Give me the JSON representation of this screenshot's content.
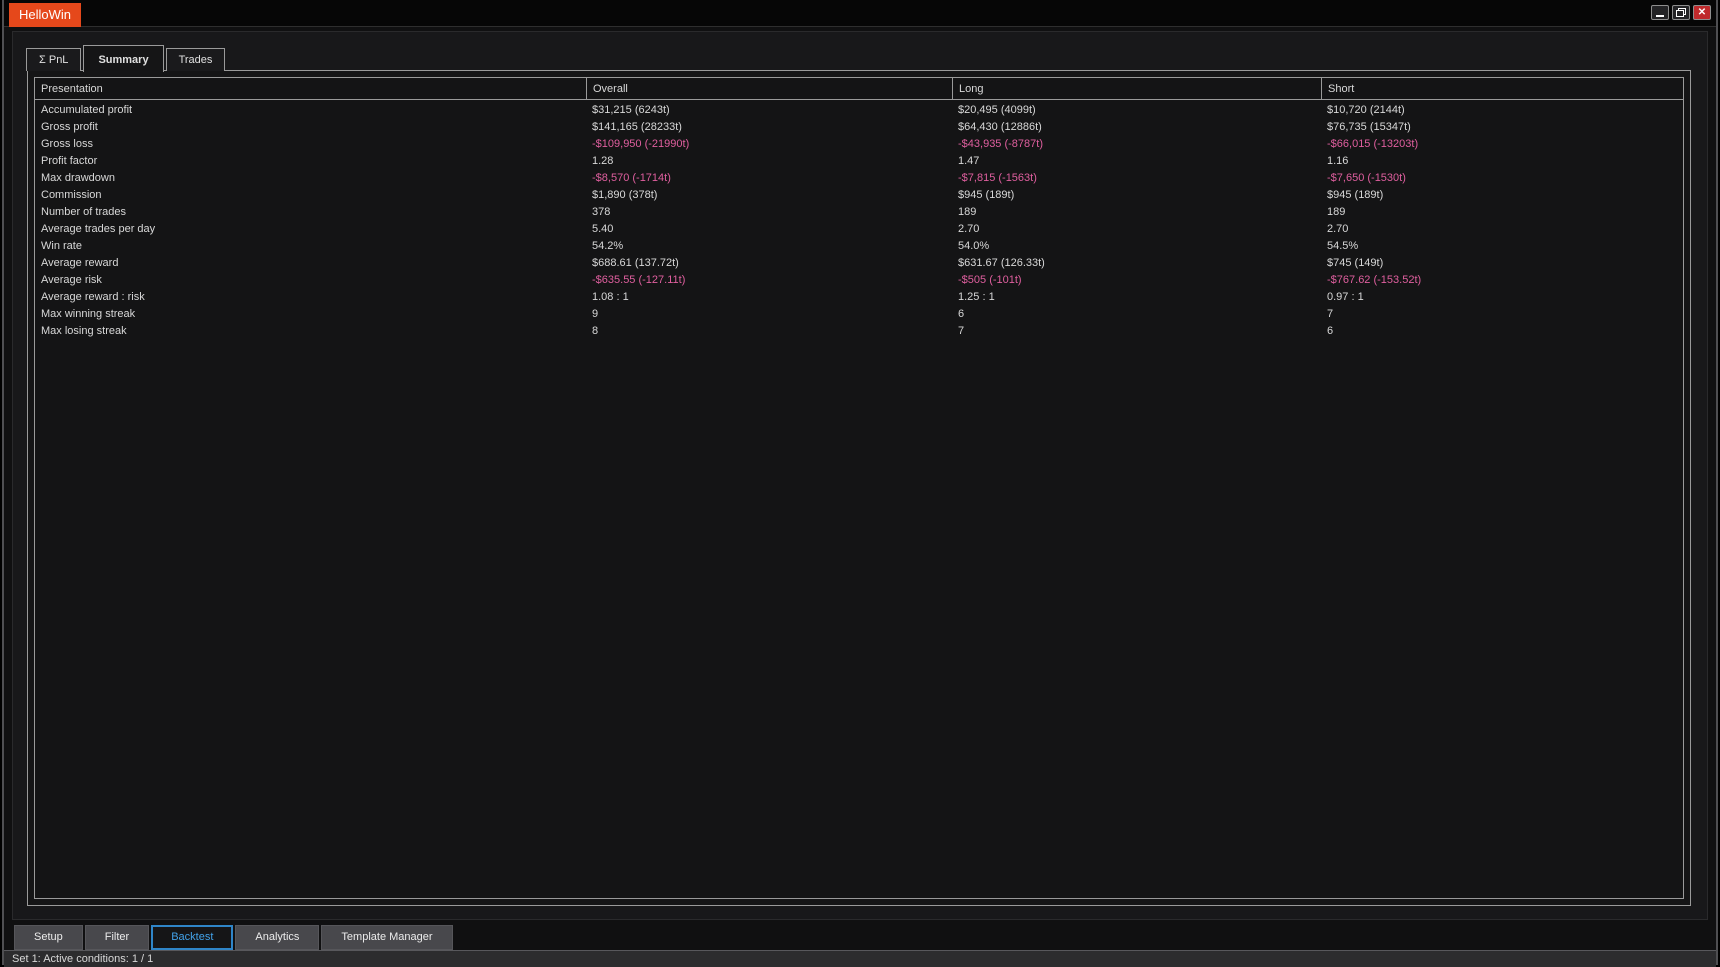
{
  "window": {
    "title": "HelloWin"
  },
  "colors": {
    "title_accent": "#e5481b",
    "negative_value": "#e05f9f",
    "active_tab_blue": "#42a1e8",
    "close_button_red": "#bf2a2c"
  },
  "top_tabs": [
    {
      "label": "Σ PnL",
      "active": false
    },
    {
      "label": "Summary",
      "active": true
    },
    {
      "label": "Trades",
      "active": false
    }
  ],
  "table": {
    "columns": [
      "Presentation",
      "Overall",
      "Long",
      "Short"
    ],
    "rows": [
      {
        "label": "Accumulated profit",
        "cells": [
          {
            "text": "$31,215 (6243t)",
            "neg": false
          },
          {
            "text": "$20,495 (4099t)",
            "neg": false
          },
          {
            "text": "$10,720 (2144t)",
            "neg": false
          }
        ]
      },
      {
        "label": "Gross profit",
        "cells": [
          {
            "text": "$141,165 (28233t)",
            "neg": false
          },
          {
            "text": "$64,430 (12886t)",
            "neg": false
          },
          {
            "text": "$76,735 (15347t)",
            "neg": false
          }
        ]
      },
      {
        "label": "Gross loss",
        "cells": [
          {
            "text": "-$109,950 (-21990t)",
            "neg": true
          },
          {
            "text": "-$43,935 (-8787t)",
            "neg": true
          },
          {
            "text": "-$66,015 (-13203t)",
            "neg": true
          }
        ]
      },
      {
        "label": "Profit factor",
        "cells": [
          {
            "text": "1.28",
            "neg": false
          },
          {
            "text": "1.47",
            "neg": false
          },
          {
            "text": "1.16",
            "neg": false
          }
        ]
      },
      {
        "label": "Max drawdown",
        "cells": [
          {
            "text": "-$8,570 (-1714t)",
            "neg": true
          },
          {
            "text": "-$7,815 (-1563t)",
            "neg": true
          },
          {
            "text": "-$7,650 (-1530t)",
            "neg": true
          }
        ]
      },
      {
        "label": "Commission",
        "cells": [
          {
            "text": "$1,890 (378t)",
            "neg": false
          },
          {
            "text": "$945 (189t)",
            "neg": false
          },
          {
            "text": "$945 (189t)",
            "neg": false
          }
        ]
      },
      {
        "label": "Number of trades",
        "cells": [
          {
            "text": "378",
            "neg": false
          },
          {
            "text": "189",
            "neg": false
          },
          {
            "text": "189",
            "neg": false
          }
        ]
      },
      {
        "label": "Average trades per day",
        "cells": [
          {
            "text": "5.40",
            "neg": false
          },
          {
            "text": "2.70",
            "neg": false
          },
          {
            "text": "2.70",
            "neg": false
          }
        ]
      },
      {
        "label": "Win rate",
        "cells": [
          {
            "text": "54.2%",
            "neg": false
          },
          {
            "text": "54.0%",
            "neg": false
          },
          {
            "text": "54.5%",
            "neg": false
          }
        ]
      },
      {
        "label": "Average reward",
        "cells": [
          {
            "text": "$688.61 (137.72t)",
            "neg": false
          },
          {
            "text": "$631.67 (126.33t)",
            "neg": false
          },
          {
            "text": "$745 (149t)",
            "neg": false
          }
        ]
      },
      {
        "label": "Average risk",
        "cells": [
          {
            "text": "-$635.55 (-127.11t)",
            "neg": true
          },
          {
            "text": "-$505 (-101t)",
            "neg": true
          },
          {
            "text": "-$767.62 (-153.52t)",
            "neg": true
          }
        ]
      },
      {
        "label": "Average reward : risk",
        "cells": [
          {
            "text": "1.08 : 1",
            "neg": false
          },
          {
            "text": "1.25 : 1",
            "neg": false
          },
          {
            "text": "0.97 : 1",
            "neg": false
          }
        ]
      },
      {
        "label": "Max winning streak",
        "cells": [
          {
            "text": "9",
            "neg": false
          },
          {
            "text": "6",
            "neg": false
          },
          {
            "text": "7",
            "neg": false
          }
        ]
      },
      {
        "label": "Max losing streak",
        "cells": [
          {
            "text": "8",
            "neg": false
          },
          {
            "text": "7",
            "neg": false
          },
          {
            "text": "6",
            "neg": false
          }
        ]
      }
    ]
  },
  "bottom_tabs": [
    {
      "label": "Setup",
      "active": false
    },
    {
      "label": "Filter",
      "active": false
    },
    {
      "label": "Backtest",
      "active": true
    },
    {
      "label": "Analytics",
      "active": false
    },
    {
      "label": "Template Manager",
      "active": false
    }
  ],
  "status_bar": {
    "text": "Set 1: Active conditions: 1 / 1"
  }
}
